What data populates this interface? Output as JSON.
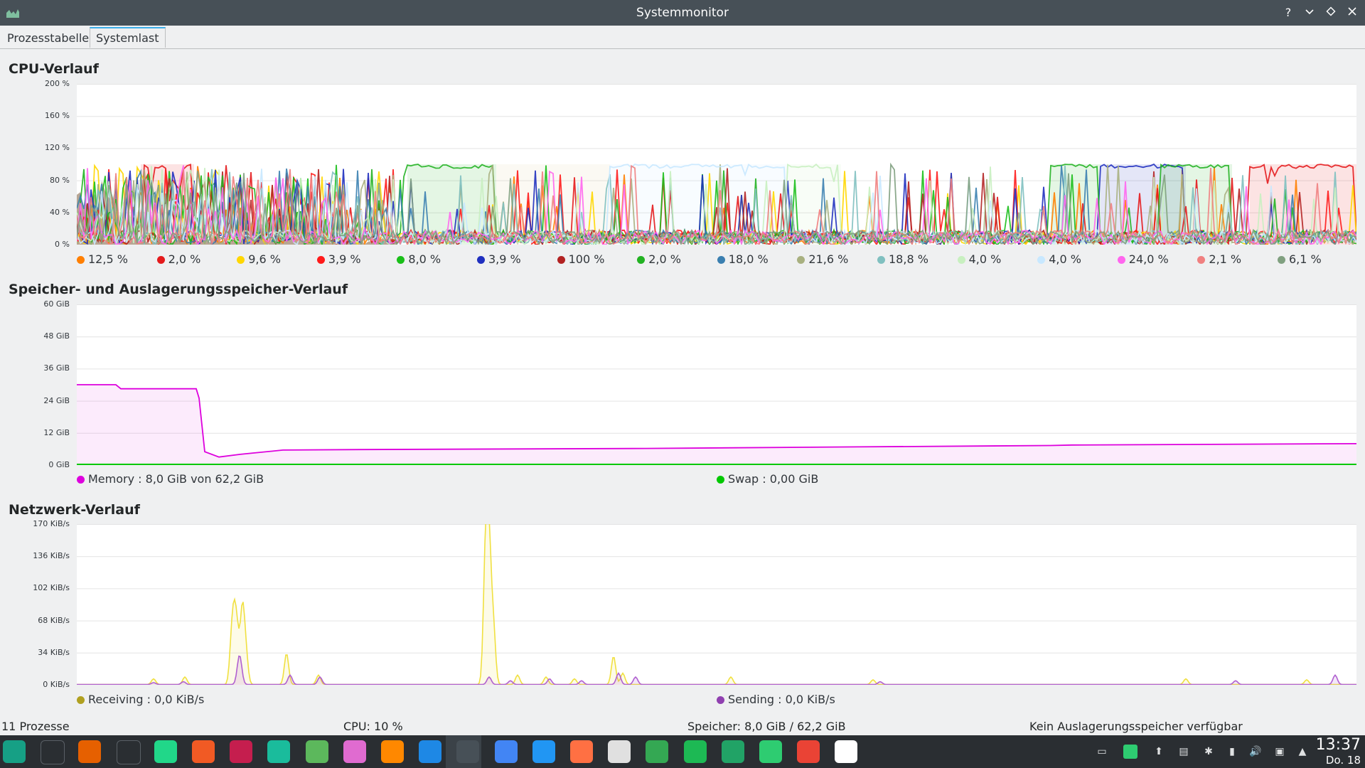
{
  "window": {
    "title": "Systemmonitor"
  },
  "tabs": [
    {
      "label": "Prozesstabelle"
    },
    {
      "label": "Systemlast"
    }
  ],
  "cpu": {
    "title": "CPU-Verlauf",
    "y_ticks": [
      "200 %",
      "160 %",
      "120 %",
      "80 %",
      "40 %",
      "0 %"
    ],
    "legend": [
      {
        "label": "12,5 %",
        "color": "#ff7f00"
      },
      {
        "label": "2,0 %",
        "color": "#e41a1c"
      },
      {
        "label": "9,6 %",
        "color": "#ffd700"
      },
      {
        "label": "3,9 %",
        "color": "#ff1a1a"
      },
      {
        "label": "8,0 %",
        "color": "#19bf19"
      },
      {
        "label": "3,9 %",
        "color": "#1f2fbf"
      },
      {
        "label": "100 %",
        "color": "#b22222"
      },
      {
        "label": "2,0 %",
        "color": "#22b222"
      },
      {
        "label": "18,0 %",
        "color": "#3a7fb0"
      },
      {
        "label": "21,6 %",
        "color": "#a8b080"
      },
      {
        "label": "18,8 %",
        "color": "#80c0c0"
      },
      {
        "label": "4,0 %",
        "color": "#c8f0c0"
      },
      {
        "label": "4,0 %",
        "color": "#c8e8ff"
      },
      {
        "label": "24,0 %",
        "color": "#ff66ee"
      },
      {
        "label": "2,1 %",
        "color": "#f08080"
      },
      {
        "label": "6,1 %",
        "color": "#80a080"
      }
    ]
  },
  "memory": {
    "title": "Speicher- und Auslagerungsspeicher-Verlauf",
    "y_ticks": [
      "60 GiB",
      "48 GiB",
      "36 GiB",
      "24 GiB",
      "12 GiB",
      "0 GiB"
    ],
    "legend": [
      {
        "label": "Memory : 8,0 GiB von 62,2 GiB",
        "color": "#dd00dd"
      },
      {
        "label": "Swap : 0,00 GiB",
        "color": "#00c800"
      }
    ]
  },
  "network": {
    "title": "Netzwerk-Verlauf",
    "y_ticks": [
      "170 KiB/s",
      "136 KiB/s",
      "102 KiB/s",
      "68 KiB/s",
      "34 KiB/s",
      "0 KiB/s"
    ],
    "legend": [
      {
        "label": "Receiving : 0,0 KiB/s",
        "color": "#b0a020"
      },
      {
        "label": "Sending : 0,0 KiB/s",
        "color": "#9040b0"
      }
    ]
  },
  "status": {
    "processes": "11 Prozesse",
    "cpu": "CPU: 10 %",
    "memory": "Speicher: 8,0 GiB / 62,2 GiB",
    "swap": "Kein Auslagerungsspeicher verfügbar"
  },
  "clock": {
    "time": "13:37",
    "date": "Do. 18"
  },
  "taskbar_icons": [
    {
      "name": "application-menu-icon",
      "color": "#16a085"
    },
    {
      "name": "settings-panel-icon",
      "color": "#2a2e32"
    },
    {
      "name": "firefox-icon",
      "color": "#e66000"
    },
    {
      "name": "terminal-icon",
      "color": "#3b4045"
    },
    {
      "name": "pycharm-icon",
      "color": "#21d789"
    },
    {
      "name": "lutris-icon",
      "color": "#f15a24"
    },
    {
      "name": "clion-icon",
      "color": "#c51e4e"
    },
    {
      "name": "network-app-icon",
      "color": "#1abc9c"
    },
    {
      "name": "download-icon",
      "color": "#5cb85c"
    },
    {
      "name": "bubble-app-icon",
      "color": "#e06bd0"
    },
    {
      "name": "vlc-icon",
      "color": "#ff8800"
    },
    {
      "name": "info-app-icon",
      "color": "#1e88e5"
    },
    {
      "name": "system-monitor-icon",
      "color": "#475057"
    },
    {
      "name": "chrome-icon",
      "color": "#4285f4"
    },
    {
      "name": "document-icon",
      "color": "#2196f3"
    },
    {
      "name": "presentation-icon",
      "color": "#ff7043"
    },
    {
      "name": "cards-game-icon",
      "color": "#e0e0e0"
    },
    {
      "name": "pinwheel-app-icon",
      "color": "#34a853"
    },
    {
      "name": "spotify-icon",
      "color": "#1db954"
    },
    {
      "name": "spreadsheet-icon",
      "color": "#21a366"
    },
    {
      "name": "file-manager-icon",
      "color": "#2ecc71"
    },
    {
      "name": "pinwheel-app-icon-2",
      "color": "#ea4335"
    },
    {
      "name": "roon-icon",
      "color": "#ffffff"
    }
  ]
}
